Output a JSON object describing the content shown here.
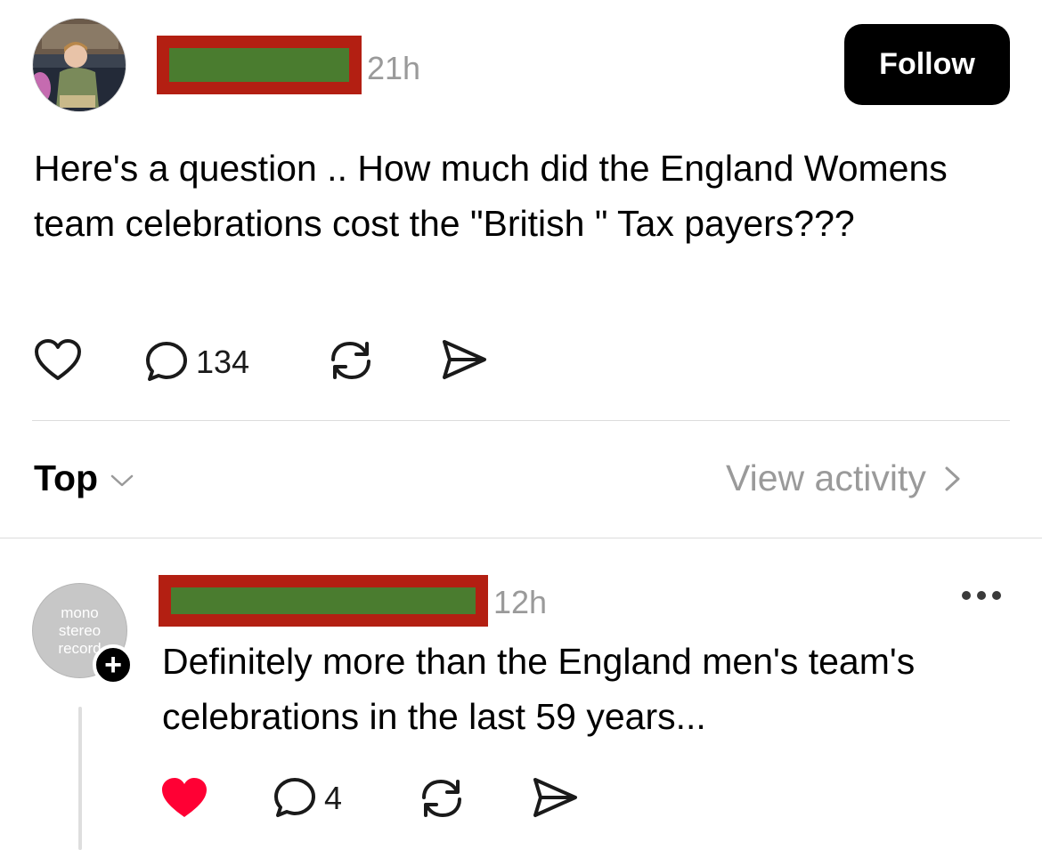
{
  "post": {
    "time": "21h",
    "follow_label": "Follow",
    "text": "Here's a question .. How much did the England Womens team celebrations cost the \"British \" Tax payers???",
    "comment_count": "134"
  },
  "sort": {
    "label": "Top",
    "view_activity_label": "View activity"
  },
  "reply": {
    "avatar_lines": [
      "mono",
      "stereo",
      "record"
    ],
    "time": "12h",
    "text": "Definitely more than the England men's team's celebrations in the last 59 years...",
    "comment_count": "4",
    "liked": true
  },
  "icons": {
    "like": "heart-icon",
    "comment": "comment-bubble-icon",
    "repost": "repost-icon",
    "share": "send-icon",
    "more": "more-dots-icon",
    "chevron_down": "chevron-down-icon",
    "chevron_right": "chevron-right-icon",
    "follow_plus": "plus-icon"
  },
  "colors": {
    "liked_heart": "#ff0034",
    "secondary_text": "#9a9a9a",
    "redaction_fill": "#4a7c2f",
    "redaction_border": "#b31f12"
  }
}
